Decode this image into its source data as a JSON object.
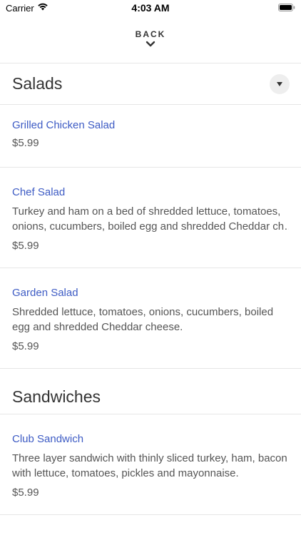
{
  "status_bar": {
    "carrier": "Carrier",
    "time": "4:03 AM"
  },
  "header": {
    "back_label": "BACK"
  },
  "sections": [
    {
      "title": "Salads",
      "items": [
        {
          "name": "Grilled Chicken Salad",
          "desc_lines": [],
          "price": "$5.99"
        },
        {
          "name": "Chef Salad",
          "desc_lines": [
            "Turkey and ham on a bed of shredded lettuce, tomatoes,",
            "onions, cucumbers, boiled egg and shredded Cheddar ch…"
          ],
          "price": "$5.99"
        },
        {
          "name": "Garden Salad",
          "desc_lines": [
            "Shredded lettuce, tomatoes, onions, cucumbers, boiled",
            "egg and shredded Cheddar cheese."
          ],
          "price": "$5.99"
        }
      ]
    },
    {
      "title": "Sandwiches",
      "items": [
        {
          "name": "Club Sandwich",
          "desc_lines": [
            "Three layer sandwich with thinly sliced turkey, ham, bacon",
            "with lettuce, tomatoes, pickles and mayonnaise."
          ],
          "price": "$5.99"
        }
      ]
    }
  ],
  "colors": {
    "item_name": "#3d5bc4",
    "divider": "#e6e6e6"
  }
}
